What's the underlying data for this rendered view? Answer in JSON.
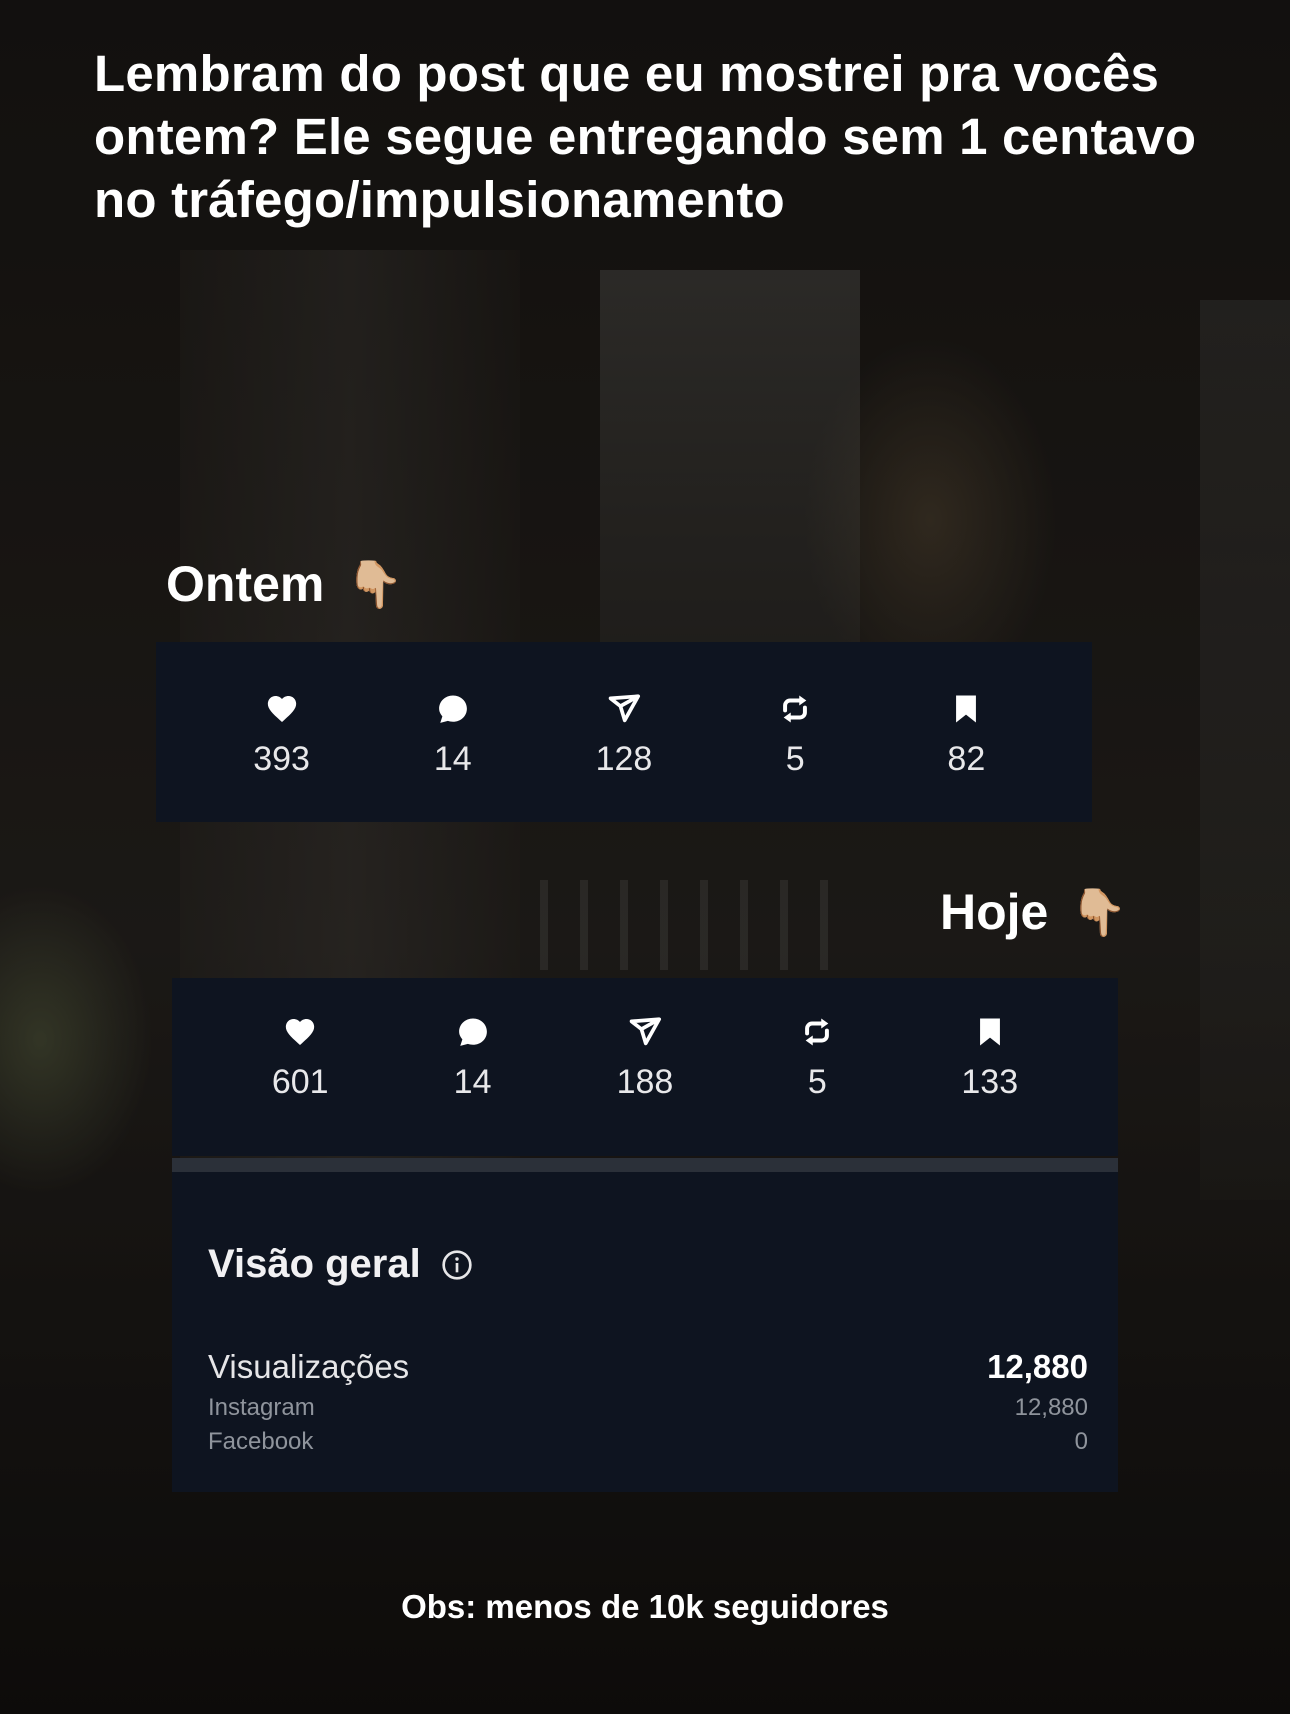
{
  "headline": "Lembram do post que eu mostrei pra vocês ontem? Ele segue entregando sem 1 centavo no tráfego/impulsionamento",
  "ontem": {
    "label": "Ontem",
    "hand_emoji": "👇🏼",
    "stats": {
      "likes": "393",
      "comments": "14",
      "shares": "128",
      "reposts": "5",
      "saves": "82"
    }
  },
  "hoje": {
    "label": "Hoje",
    "hand_emoji": "👇🏼",
    "stats": {
      "likes": "601",
      "comments": "14",
      "shares": "188",
      "reposts": "5",
      "saves": "133"
    }
  },
  "overview": {
    "title": "Visão geral",
    "views_label": "Visualizações",
    "views_total": "12,880",
    "instagram_label": "Instagram",
    "instagram_value": "12,880",
    "facebook_label": "Facebook",
    "facebook_value": "0"
  },
  "footnote": "Obs: menos de 10k seguidores",
  "icons": {
    "likes": "heart-icon",
    "comments": "comment-icon",
    "shares": "share-icon",
    "reposts": "repost-icon",
    "saves": "bookmark-icon",
    "info": "info-icon"
  },
  "colors": {
    "card_bg": "#0e1420",
    "divider": "#2b3039",
    "text_primary": "#ffffff",
    "text_secondary": "#8f949c"
  }
}
